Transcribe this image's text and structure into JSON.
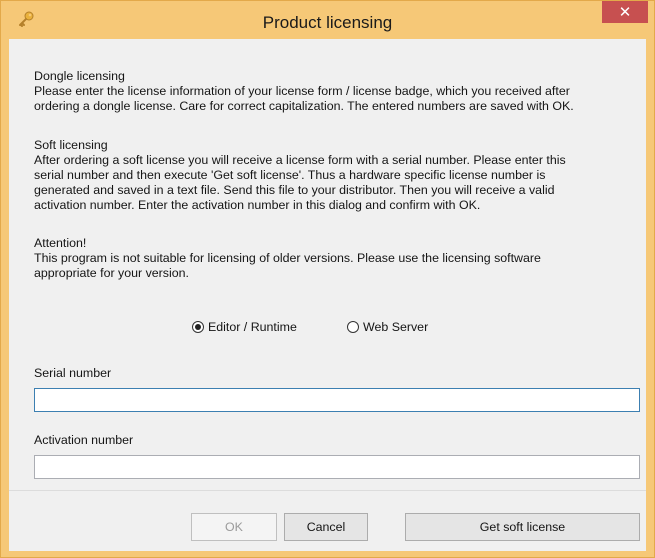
{
  "window": {
    "title": "Product licensing",
    "close_label": "✕"
  },
  "body": {
    "dongle_text": "Dongle licensing\nPlease enter the license information of your license form / license badge, which you received after\nordering a dongle license. Care for correct capitalization. The entered numbers are saved with OK.",
    "soft_text": "Soft licensing\nAfter ordering a soft license you will receive a license form with a serial number. Please enter this\nserial number and then execute 'Get soft license'. Thus a hardware specific license number is\ngenerated and saved in a text file. Send this file to your distributor. Then you will receive a valid\nactivation number. Enter the activation number in this dialog and confirm with OK.",
    "attention_text": "Attention!\nThis program is not suitable for licensing of older versions. Please use the licensing software\nappropriate for your version."
  },
  "mode": {
    "options": [
      {
        "label": "Editor / Runtime",
        "selected": true
      },
      {
        "label": "Web Server",
        "selected": false
      }
    ]
  },
  "fields": {
    "serial_label": "Serial number",
    "serial_value": "",
    "activation_label": "Activation number",
    "activation_value": ""
  },
  "buttons": {
    "ok_label": "OK",
    "cancel_label": "Cancel",
    "get_soft_label": "Get soft license"
  },
  "colors": {
    "titlebar": "#f6c877",
    "close": "#c75050",
    "client": "#f0f0f0"
  },
  "icons": {
    "app": "key-icon",
    "close": "close-icon"
  }
}
